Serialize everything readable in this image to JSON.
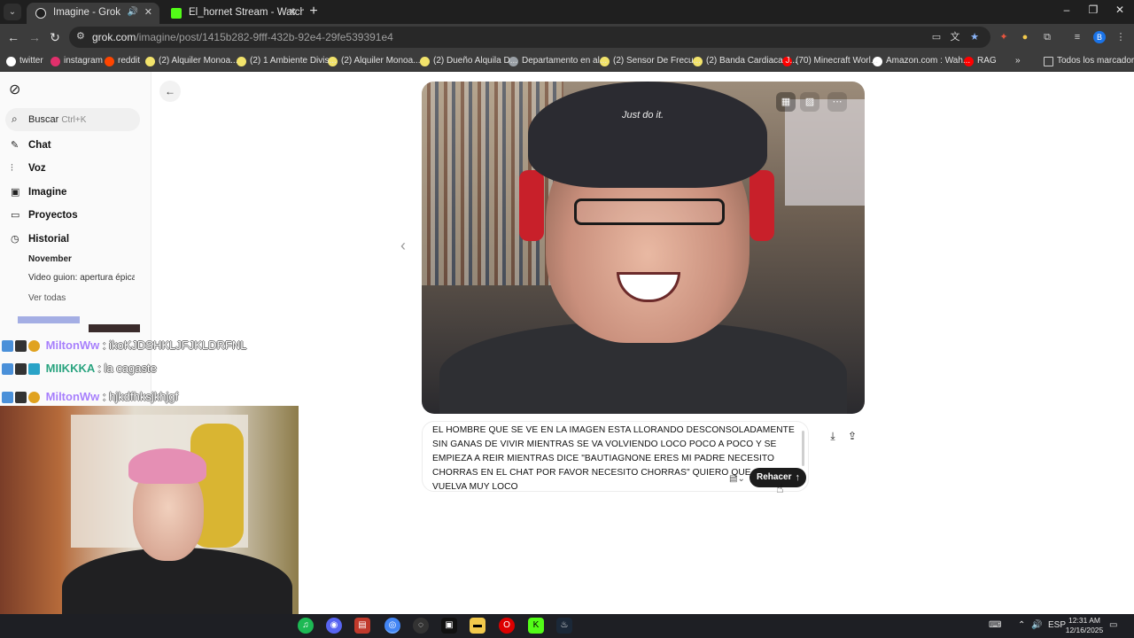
{
  "browser": {
    "tabs": [
      {
        "title": "Imagine - Grok",
        "active": true,
        "audio": true
      },
      {
        "title": "El_hornet Stream - Watch Live c",
        "active": false
      }
    ],
    "url_host": "grok.com",
    "url_path": "/imagine/post/1415b282-9fff-432b-92e4-29fe539391e4",
    "bookmarks": [
      {
        "label": "twitter",
        "color": "#ffffff"
      },
      {
        "label": "instagram",
        "color": "#e1306c"
      },
      {
        "label": "reddit",
        "color": "#ff4500"
      },
      {
        "label": "(2) Alquiler Monoa...",
        "color": "#f2e36b"
      },
      {
        "label": "(2) 1 Ambiente Divis...",
        "color": "#f2e36b"
      },
      {
        "label": "(2) Alquiler Monoa...",
        "color": "#f2e36b"
      },
      {
        "label": "(2) Dueño Alquila D...",
        "color": "#f2e36b"
      },
      {
        "label": "Departamento en al...",
        "color": "#9aa0a6"
      },
      {
        "label": "(2) Sensor De Frecu...",
        "color": "#f2e36b"
      },
      {
        "label": "(2) Banda Cardiaca J...",
        "color": "#f2e36b"
      },
      {
        "label": "(70) Minecraft Worl...",
        "color": "#ff0000"
      },
      {
        "label": "Amazon.com : Wah...",
        "color": "#ffffff"
      },
      {
        "label": "RAG",
        "color": "#ff0000"
      }
    ],
    "bookmarks_overflow": "»",
    "all_bookmarks": "Todos los marcadores"
  },
  "sidebar": {
    "search_label": "Buscar",
    "search_shortcut": "Ctrl+K",
    "nav": [
      {
        "label": "Chat",
        "icon": "compose-icon"
      },
      {
        "label": "Voz",
        "icon": "waveform-icon"
      },
      {
        "label": "Imagine",
        "icon": "image-icon"
      },
      {
        "label": "Proyectos",
        "icon": "folder-icon"
      },
      {
        "label": "Historial",
        "icon": "history-icon"
      }
    ],
    "history_month": "November",
    "history_item": "Video guion: apertura épica",
    "see_all": "Ver todas"
  },
  "main": {
    "image_caption_text": "Just do it.",
    "prompt": "EL HOMBRE QUE SE VE EN LA IMAGEN ESTA LLORANDO DESCONSOLADAMENTE SIN GANAS DE VIVIR MIENTRAS SE VA VOLVIENDO LOCO POCO A POCO Y SE EMPIEZA A REIR MIENTRAS DICE \"BAUTIAGNONE ERES MI PADRE NECESITO CHORRAS EN EL CHAT POR FAVOR NECESITO CHORRAS\" QUIERO QUE SE VUELVA MUY LOCO",
    "submit_label": "Rehacer"
  },
  "stream_chat": [
    {
      "user": "MiltonWw",
      "message": ": ikoKJDSHKLJFJKLDRFNL",
      "color": "#a77ffb"
    },
    {
      "user": "MIIKKKA",
      "message": ": la cagaste",
      "color": "#2aa37f"
    },
    {
      "user": "MiltonWw",
      "message": ": hjkdfhksjkhjgf",
      "color": "#a77ffb"
    }
  ],
  "taskbar": {
    "lang": "ESP",
    "time": "12:31 AM",
    "date": "12/16/2025"
  }
}
